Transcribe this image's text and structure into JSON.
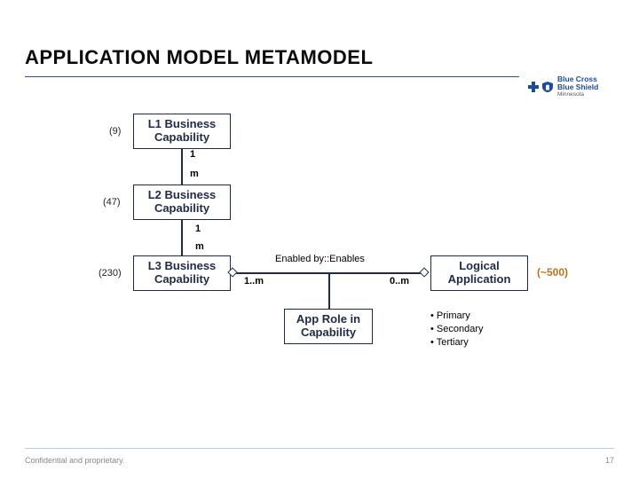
{
  "title": "APPLICATION MODEL METAMODEL",
  "logo": {
    "line1": "Blue Cross",
    "line2": "Blue Shield",
    "sub": "Minnesota"
  },
  "counts": {
    "l1": "(9)",
    "l2": "(47)",
    "l3": "(230)",
    "app": "(~500)"
  },
  "boxes": {
    "l1": "L1 Business Capability",
    "l2": "L2 Business Capability",
    "l3": "L3 Business Capability",
    "app": "Logical Application",
    "role": "App Role in Capability"
  },
  "cardinality": {
    "one_a": "1",
    "many_a": "m",
    "one_b": "1",
    "many_b": "m",
    "left": "1..m",
    "right": "0..m"
  },
  "rel_label": "Enabled by::Enables",
  "roles": {
    "r1": "Primary",
    "r2": "Secondary",
    "r3": "Tertiary"
  },
  "footer": "Confidential and proprietary.",
  "page_number": "17"
}
